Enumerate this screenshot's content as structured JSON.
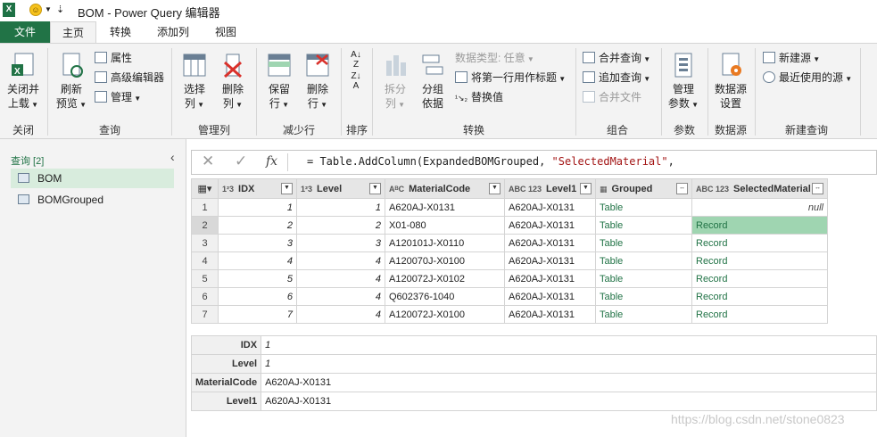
{
  "window": {
    "title": "BOM - Power Query 编辑器"
  },
  "ribbon_tabs": [
    "文件",
    "主页",
    "转换",
    "添加列",
    "视图"
  ],
  "ribbon": {
    "close": {
      "label1": "关闭并",
      "label2": "上载",
      "group": "关闭"
    },
    "query": {
      "refresh1": "刷新",
      "refresh2": "预览",
      "properties": "属性",
      "advanced": "高级编辑器",
      "manage": "管理",
      "group": "查询"
    },
    "columns": {
      "choose1": "选择",
      "choose2": "列",
      "remove1": "删除",
      "remove2": "列",
      "group": "管理列"
    },
    "rows": {
      "keep1": "保留",
      "keep2": "行",
      "remove1": "删除",
      "remove2": "行",
      "group": "减少行"
    },
    "sort": {
      "group": "排序"
    },
    "transform": {
      "split1": "拆分",
      "split2": "列",
      "groupby1": "分组",
      "groupby2": "依据",
      "datatype": "数据类型: 任意",
      "first_row": "将第一行用作标题",
      "replace": "替换值",
      "group": "转换"
    },
    "combine": {
      "merge": "合并查询",
      "append": "追加查询",
      "merge_files": "合并文件",
      "group": "组合"
    },
    "parameters": {
      "manage1": "管理",
      "manage2": "参数",
      "group": "参数"
    },
    "datasource": {
      "settings1": "数据源",
      "settings2": "设置",
      "group": "数据源"
    },
    "newquery": {
      "new_source": "新建源",
      "recent": "最近使用的源",
      "group": "新建查询"
    }
  },
  "queries_pane": {
    "header": "查询 [2]",
    "items": [
      "BOM",
      "BOMGrouped"
    ]
  },
  "formula_bar": {
    "prefix": "= Table.AddColumn(ExpandedBOMGrouped, ",
    "string": "\"SelectedMaterial\"",
    "suffix": ","
  },
  "grid": {
    "columns": [
      {
        "type": "1²3",
        "name": "IDX"
      },
      {
        "type": "1²3",
        "name": "Level"
      },
      {
        "type": "AᴮC",
        "name": "MaterialCode"
      },
      {
        "type": "ABC 123",
        "name": "Level1"
      },
      {
        "type": "",
        "name": "Grouped"
      },
      {
        "type": "ABC 123",
        "name": "SelectedMaterial"
      }
    ],
    "rows": [
      {
        "n": "1",
        "idx": "1",
        "level": "1",
        "code": "A620AJ-X0131",
        "level1": "A620AJ-X0131",
        "grouped": "Table",
        "sel": "null"
      },
      {
        "n": "2",
        "idx": "2",
        "level": "2",
        "code": "X01-080",
        "level1": "A620AJ-X0131",
        "grouped": "Table",
        "sel": "Record"
      },
      {
        "n": "3",
        "idx": "3",
        "level": "3",
        "code": "A120101J-X0110",
        "level1": "A620AJ-X0131",
        "grouped": "Table",
        "sel": "Record"
      },
      {
        "n": "4",
        "idx": "4",
        "level": "4",
        "code": "A120070J-X0100",
        "level1": "A620AJ-X0131",
        "grouped": "Table",
        "sel": "Record"
      },
      {
        "n": "5",
        "idx": "5",
        "level": "4",
        "code": "A120072J-X0102",
        "level1": "A620AJ-X0131",
        "grouped": "Table",
        "sel": "Record"
      },
      {
        "n": "6",
        "idx": "6",
        "level": "4",
        "code": "Q602376-1040",
        "level1": "A620AJ-X0131",
        "grouped": "Table",
        "sel": "Record"
      },
      {
        "n": "7",
        "idx": "7",
        "level": "4",
        "code": "A120072J-X0100",
        "level1": "A620AJ-X0131",
        "grouped": "Table",
        "sel": "Record"
      }
    ]
  },
  "detail": [
    {
      "key": "IDX",
      "value": "1"
    },
    {
      "key": "Level",
      "value": "1"
    },
    {
      "key": "MaterialCode",
      "value": "A620AJ-X0131"
    },
    {
      "key": "Level1",
      "value": "A620AJ-X0131"
    }
  ],
  "watermark": "https://blog.csdn.net/stone0823",
  "colors": {
    "accent": "#217346",
    "selected_cell": "#9fd5b1"
  }
}
